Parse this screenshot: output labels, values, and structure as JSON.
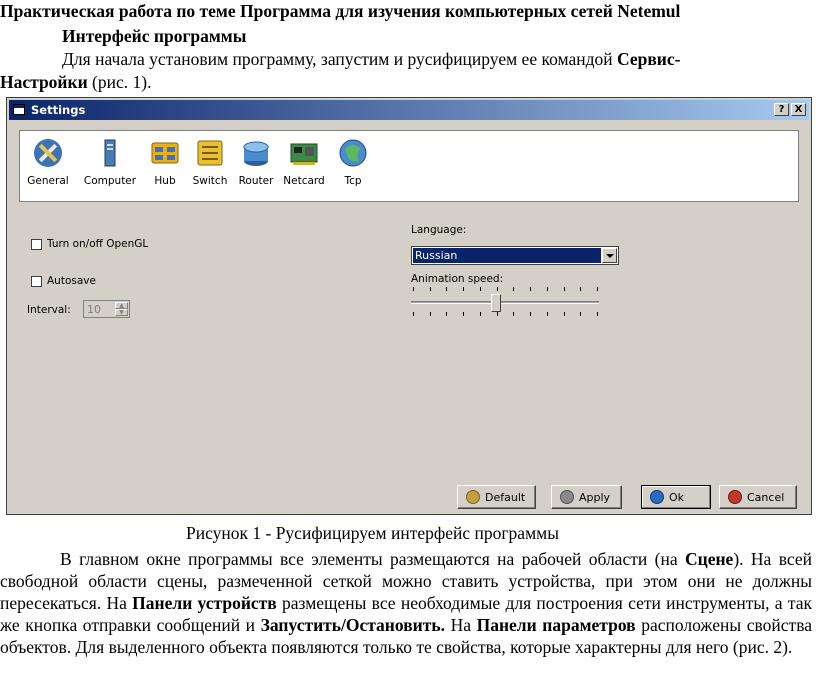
{
  "doc": {
    "heading": "Практическая работа по теме Программа для изучения компьютерных сетей Netemul",
    "subheading": "Интерфейс программы",
    "intro_line1": "Для начала установим программу, запустим и русифицируем ее командой ",
    "intro_bold1": "Сервис-",
    "intro_bold2": "Настройки",
    "intro_end": " (рис. 1).",
    "caption": "Рисунок 1 - Русифицируем интерфейс программы",
    "p_t1": "В главном окне программы все элементы размещаются на рабочей области (на ",
    "p_b1": "Сцене",
    "p_t2": "). На всей свободной области сцены, размеченной сеткой можно ставить устройства, при этом они не должны пересекаться. На ",
    "p_b2": "Панели устройств",
    "p_t3": " размещены все необходимые для построения сети инструменты, а так же кнопка отправки сообщений и ",
    "p_b3": "Запустить/Остановить.",
    "p_t4": " На ",
    "p_b4": "Панели параметров",
    "p_t5": " расположены свойства объектов. Для выделенного объекта появляются только те свойства, которые характерны для него (рис. 2)."
  },
  "dialog": {
    "title": "Settings",
    "help_btn": "?",
    "close_btn": "X",
    "tools": [
      {
        "label": "General",
        "icon": "wrench-screwdriver-icon"
      },
      {
        "label": "Computer",
        "icon": "computer-icon"
      },
      {
        "label": "Hub",
        "icon": "hub-icon"
      },
      {
        "label": "Switch",
        "icon": "switch-icon"
      },
      {
        "label": "Router",
        "icon": "router-icon"
      },
      {
        "label": "Netcard",
        "icon": "netcard-icon"
      },
      {
        "label": "Tcp",
        "icon": "tcp-icon"
      }
    ],
    "opengl_label": "Turn on/off OpenGL",
    "opengl_checked": false,
    "autosave_label": "Autosave",
    "autosave_checked": false,
    "interval_label": "Interval:",
    "interval_value": "10",
    "language_label": "Language:",
    "language_value": "Russian",
    "animation_label": "Animation speed:",
    "animation_level": 0.45,
    "buttons": {
      "default": "Default",
      "apply": "Apply",
      "ok": "Ok",
      "cancel": "Cancel"
    }
  }
}
